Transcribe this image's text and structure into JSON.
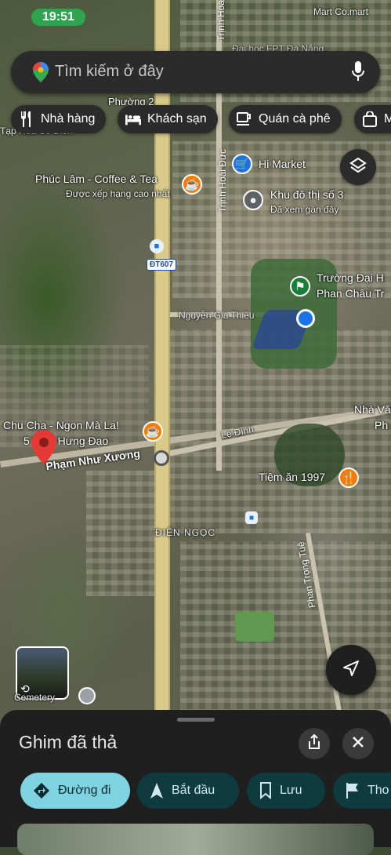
{
  "status_bar": {
    "time": "19:51",
    "top_right_label": "Mart Co.mart",
    "top_label_partial": "Đại học FPT Đà Nẵng"
  },
  "search": {
    "placeholder": "Tìm kiếm ở đây"
  },
  "chips": [
    {
      "label": "Nhà hàng",
      "icon": "fork-knife-icon"
    },
    {
      "label": "Khách sạn",
      "icon": "bed-icon"
    },
    {
      "label": "Quán cà phê",
      "icon": "coffee-cup-icon"
    },
    {
      "label": "M",
      "icon": "shopping-bag-icon"
    }
  ],
  "map_labels": {
    "phuong": "Phường 2",
    "tap_hoa": "Tạp Hóa Cô Điền",
    "phuc_lam_name": "Phúc Lâm - Coffee & Tea",
    "phuc_lam_sub": "Được xếp hạng cao nhất",
    "hi_market": "Hi Market",
    "khu_do_thi": "Khu đô thị số 3",
    "khu_do_thi_sub": "Đã xem gần đây",
    "truong_dh_line1": "Trường Đại H",
    "truong_dh_line2": "Phan Châu Tr",
    "nguyen_gia_thieu": "Nguyễn Gia Thiều",
    "dt607": "ĐT607",
    "trinh_hoai_duc": "Trịnh Hoài Đức",
    "trinh_hoai_top": "Trịnh Hoà",
    "nha_van_line1": "Nhà Vă",
    "nha_van_line2": "Ph",
    "chu_cha": "Chu Cha - Ngon Mà La!",
    "tran_hung_dao": "5 Trần Hưng Đạo",
    "le_dinh": "Lê Đình",
    "pham_nhu_xuong": "Phạm Như Xương",
    "tiem_an": "Tiệm ăn 1997",
    "dien_ngoc": "ĐIỆN NGỌC",
    "phan_trong_tue": "Phan Trọng Tuệ",
    "cemetery": "Cemetery"
  },
  "sheet": {
    "title": "Ghim đã thả",
    "actions": [
      {
        "label": "Đường đi",
        "icon": "directions-icon"
      },
      {
        "label": "Bắt đầu",
        "icon": "navigation-arrow-icon"
      },
      {
        "label": "Lưu",
        "icon": "bookmark-icon"
      },
      {
        "label": "Tho",
        "icon": "flag-icon"
      }
    ]
  },
  "colors": {
    "accent": "#7fd3e0",
    "pin_red": "#e53935",
    "location_blue": "#1a73e8",
    "poi_orange": "#f57c00"
  }
}
